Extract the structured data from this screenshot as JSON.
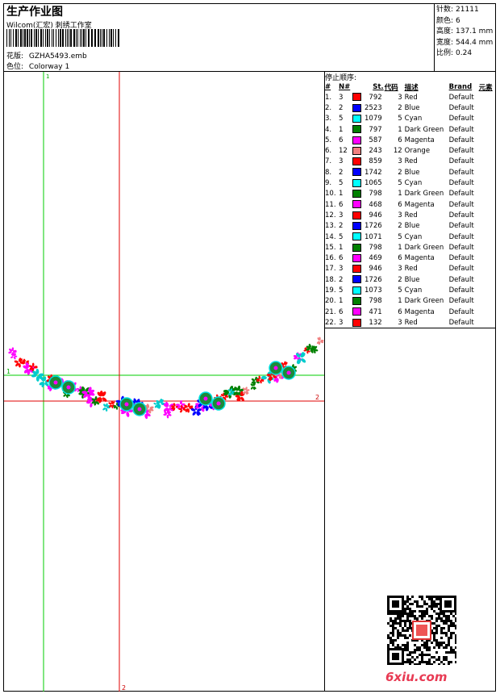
{
  "header": {
    "title": "生产作业图",
    "company": "Wilcom(汇宏) 刺绣工作室",
    "pattern_label": "花版:",
    "pattern_value": "GZHA5493.emb",
    "colorway_label": "色位:",
    "colorway_value": "Colorway 1"
  },
  "stats": [
    {
      "label": "针数:",
      "value": "21111"
    },
    {
      "label": "颜色:",
      "value": "6"
    },
    {
      "label": "高度:",
      "value": "137.1 mm"
    },
    {
      "label": "宽度:",
      "value": "544.4 mm"
    },
    {
      "label": "比例:",
      "value": "0.24"
    }
  ],
  "stop_sequence": {
    "title": "停止顺序:",
    "columns": [
      "#",
      "N#",
      "St.",
      "代码",
      "描述",
      "Brand",
      "元素"
    ],
    "rows": [
      {
        "idx": "1.",
        "n": "3",
        "color": "#ff0000",
        "st": "792",
        "code": "3",
        "desc": "Red",
        "brand": "Default"
      },
      {
        "idx": "2.",
        "n": "2",
        "color": "#0000ff",
        "st": "2523",
        "code": "2",
        "desc": "Blue",
        "brand": "Default"
      },
      {
        "idx": "3.",
        "n": "5",
        "color": "#00ffff",
        "st": "1079",
        "code": "5",
        "desc": "Cyan",
        "brand": "Default"
      },
      {
        "idx": "4.",
        "n": "1",
        "color": "#008000",
        "st": "797",
        "code": "1",
        "desc": "Dark Green",
        "brand": "Default"
      },
      {
        "idx": "5.",
        "n": "6",
        "color": "#ff00ff",
        "st": "587",
        "code": "6",
        "desc": "Magenta",
        "brand": "Default"
      },
      {
        "idx": "6.",
        "n": "12",
        "color": "#f08080",
        "st": "243",
        "code": "12",
        "desc": "Orange",
        "brand": "Default"
      },
      {
        "idx": "7.",
        "n": "3",
        "color": "#ff0000",
        "st": "859",
        "code": "3",
        "desc": "Red",
        "brand": "Default"
      },
      {
        "idx": "8.",
        "n": "2",
        "color": "#0000ff",
        "st": "1742",
        "code": "2",
        "desc": "Blue",
        "brand": "Default"
      },
      {
        "idx": "9.",
        "n": "5",
        "color": "#00ffff",
        "st": "1065",
        "code": "5",
        "desc": "Cyan",
        "brand": "Default"
      },
      {
        "idx": "10.",
        "n": "1",
        "color": "#008000",
        "st": "798",
        "code": "1",
        "desc": "Dark Green",
        "brand": "Default"
      },
      {
        "idx": "11.",
        "n": "6",
        "color": "#ff00ff",
        "st": "468",
        "code": "6",
        "desc": "Magenta",
        "brand": "Default"
      },
      {
        "idx": "12.",
        "n": "3",
        "color": "#ff0000",
        "st": "946",
        "code": "3",
        "desc": "Red",
        "brand": "Default"
      },
      {
        "idx": "13.",
        "n": "2",
        "color": "#0000ff",
        "st": "1726",
        "code": "2",
        "desc": "Blue",
        "brand": "Default"
      },
      {
        "idx": "14.",
        "n": "5",
        "color": "#00ffff",
        "st": "1071",
        "code": "5",
        "desc": "Cyan",
        "brand": "Default"
      },
      {
        "idx": "15.",
        "n": "1",
        "color": "#008000",
        "st": "798",
        "code": "1",
        "desc": "Dark Green",
        "brand": "Default"
      },
      {
        "idx": "16.",
        "n": "6",
        "color": "#ff00ff",
        "st": "469",
        "code": "6",
        "desc": "Magenta",
        "brand": "Default"
      },
      {
        "idx": "17.",
        "n": "3",
        "color": "#ff0000",
        "st": "946",
        "code": "3",
        "desc": "Red",
        "brand": "Default"
      },
      {
        "idx": "18.",
        "n": "2",
        "color": "#0000ff",
        "st": "1726",
        "code": "2",
        "desc": "Blue",
        "brand": "Default"
      },
      {
        "idx": "19.",
        "n": "5",
        "color": "#00ffff",
        "st": "1073",
        "code": "5",
        "desc": "Cyan",
        "brand": "Default"
      },
      {
        "idx": "20.",
        "n": "1",
        "color": "#008000",
        "st": "798",
        "code": "1",
        "desc": "Dark Green",
        "brand": "Default"
      },
      {
        "idx": "21.",
        "n": "6",
        "color": "#ff00ff",
        "st": "471",
        "code": "6",
        "desc": "Magenta",
        "brand": "Default"
      },
      {
        "idx": "22.",
        "n": "3",
        "color": "#ff0000",
        "st": "132",
        "code": "3",
        "desc": "Red",
        "brand": "Default"
      }
    ]
  },
  "canvas": {
    "guide_labels": {
      "green_v": "1",
      "green_h": "1",
      "red_h": "2",
      "red_v": "2"
    },
    "guide_colors": {
      "green": "#00cc00",
      "red": "#e00000"
    }
  },
  "watermark": {
    "site": "6xiu.com",
    "qr_icon": "qr-code-icon"
  }
}
